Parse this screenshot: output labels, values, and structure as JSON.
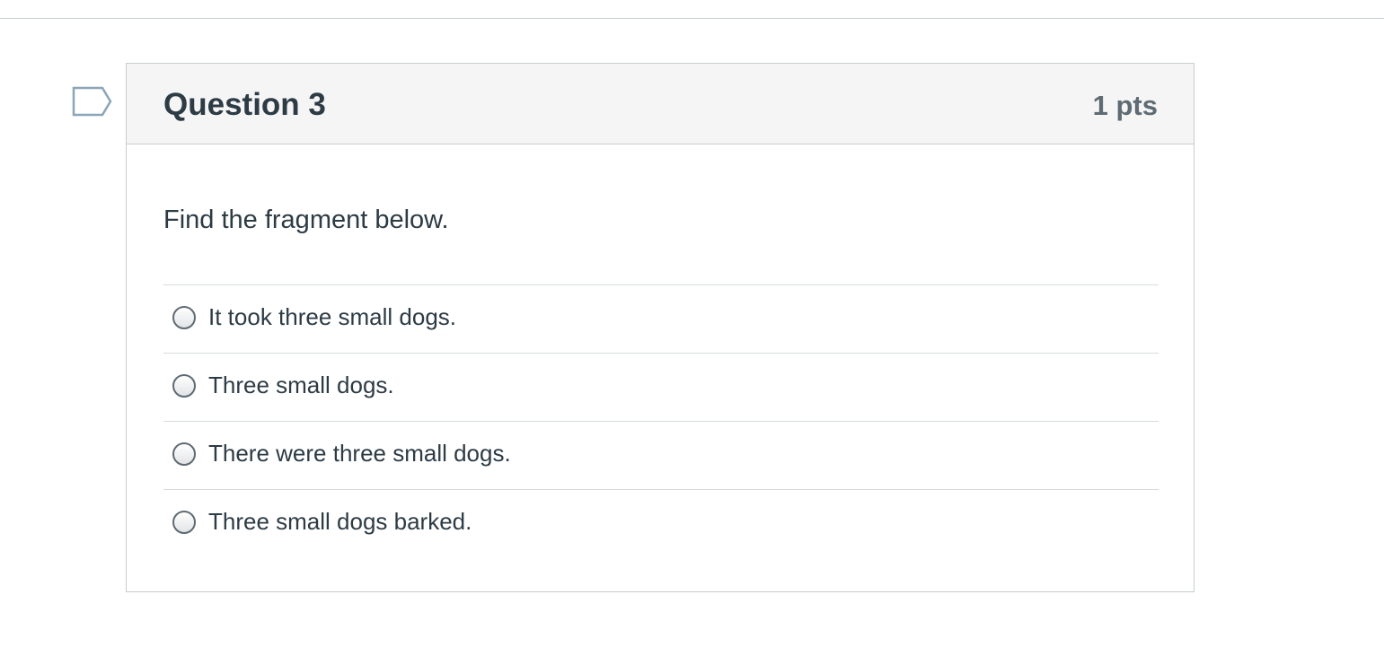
{
  "question": {
    "title": "Question 3",
    "points": "1 pts",
    "prompt": "Find the fragment below.",
    "flag_icon": "flag-icon",
    "answers": [
      {
        "label": "It took three small dogs.",
        "selected": false
      },
      {
        "label": "Three small dogs.",
        "selected": false
      },
      {
        "label": "There were three small dogs.",
        "selected": false
      },
      {
        "label": "Three small dogs barked.",
        "selected": false
      }
    ]
  },
  "colors": {
    "text": "#2d3b45",
    "muted": "#5f6b73",
    "border": "#c7cdd1",
    "header_bg": "#f5f5f5",
    "flag": "#8aa6b8"
  }
}
